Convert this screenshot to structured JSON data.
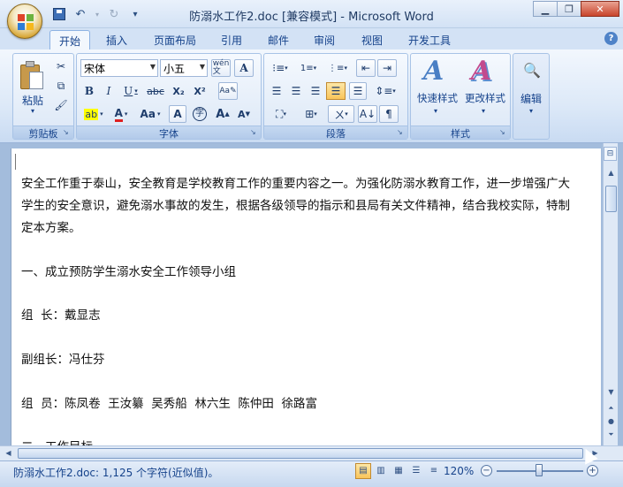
{
  "window": {
    "title": "防溺水工作2.doc [兼容模式] - Microsoft Word",
    "controls": [
      "_",
      "□",
      "X"
    ]
  },
  "qat": {
    "save_icon": "save-icon",
    "undo_icon": "undo-icon",
    "redo_icon": "redo-icon",
    "more": "▾"
  },
  "tabs": [
    "开始",
    "插入",
    "页面布局",
    "引用",
    "邮件",
    "审阅",
    "视图",
    "开发工具"
  ],
  "active_tab": "开始",
  "ribbon": {
    "clipboard": {
      "label": "剪贴板",
      "paste": "粘贴"
    },
    "font": {
      "label": "字体",
      "font_name": "宋体",
      "font_size": "小五",
      "wen": "wén\n文",
      "bold": "B",
      "italic": "I",
      "underline": "U",
      "strike": "abc",
      "sub": "X₂",
      "sup": "X²",
      "highlight": "ab",
      "font_color": "A",
      "change_case": "Aa",
      "grow": "A",
      "shrink": "A"
    },
    "paragraph": {
      "label": "段落"
    },
    "styles": {
      "label": "样式",
      "quick": "快速样式",
      "change": "更改样式"
    },
    "editing": {
      "label": "编辑"
    }
  },
  "document": {
    "lines": [
      "安全工作重于泰山，安全教育是学校教育工作的重要内容之一。为强化防溺水教育工作，进一步增强广大",
      "学生的安全意识，避免溺水事故的发生，根据各级领导的指示和县局有关文件精神，结合我校实际，特制",
      "定本方案。",
      "",
      "一、成立预防学生溺水安全工作领导小组",
      "",
      "组  长：戴显志",
      "",
      "副组长：冯仕芬",
      "",
      "组  员：陈凤卷  王汝纂  吴秀船  林六生  陈仲田  徐路富",
      "",
      "二、工作目标"
    ]
  },
  "status": {
    "text": "防溺水工作2.doc: 1,125 个字符(近似值)。",
    "zoom": "120%",
    "zoom_level": 1.2
  }
}
